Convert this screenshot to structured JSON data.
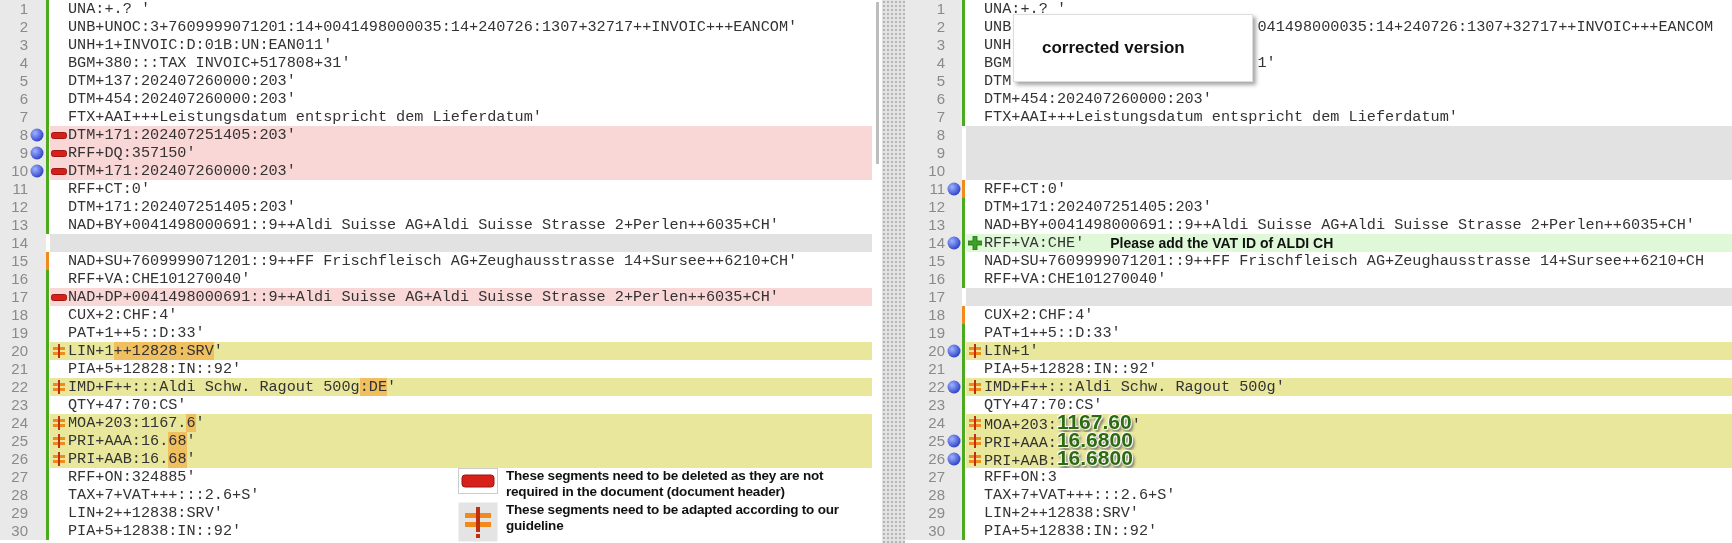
{
  "left": {
    "rows": [
      {
        "number": "1",
        "kind": "normal",
        "color": "#4caa1e",
        "dot": false,
        "text": "UNA:+.? '"
      },
      {
        "number": "2",
        "kind": "normal",
        "color": "#4caa1e",
        "dot": false,
        "text": "UNB+UNOC:3+7609999071201:14+0041498000035:14+240726:1307+32717++INVOIC+++EANCOM'"
      },
      {
        "number": "3",
        "kind": "normal",
        "color": "#4caa1e",
        "dot": false,
        "text": "UNH+1+INVOIC:D:01B:UN:EAN011'"
      },
      {
        "number": "4",
        "kind": "normal",
        "color": "#4caa1e",
        "dot": false,
        "text": "BGM+380:::TAX INVOIC+517808+31'"
      },
      {
        "number": "5",
        "kind": "normal",
        "color": "#4caa1e",
        "dot": false,
        "text": "DTM+137:202407260000:203'"
      },
      {
        "number": "6",
        "kind": "normal",
        "color": "#4caa1e",
        "dot": false,
        "text": "DTM+454:202407260000:203'"
      },
      {
        "number": "7",
        "kind": "normal",
        "color": "#4caa1e",
        "dot": false,
        "text": "FTX+AAI+++Leistungsdatum entspricht dem Lieferdatum'"
      },
      {
        "number": "8",
        "kind": "deleted",
        "color": "#4caa1e",
        "dot": true,
        "text": "DTM+171:202407251405:203'"
      },
      {
        "number": "9",
        "kind": "deleted",
        "color": "#4caa1e",
        "dot": true,
        "text": "RFF+DQ:357150'"
      },
      {
        "number": "10",
        "kind": "deleted",
        "color": "#4caa1e",
        "dot": true,
        "text": "DTM+171:202407260000:203'"
      },
      {
        "number": "11",
        "kind": "normal",
        "color": "#4caa1e",
        "dot": false,
        "text": "RFF+CT:0'"
      },
      {
        "number": "12",
        "kind": "normal",
        "color": "#4caa1e",
        "dot": false,
        "text": "DTM+171:202407251405:203'"
      },
      {
        "number": "13",
        "kind": "normal",
        "color": "#4caa1e",
        "dot": false,
        "text": "NAD+BY+0041498000691::9++Aldi Suisse AG+Aldi Suisse Strasse 2+Perlen++6035+CH'"
      },
      {
        "number": "14",
        "kind": "blank",
        "dot": false
      },
      {
        "number": "15",
        "kind": "normal",
        "color": "#f08a1c",
        "dot": false,
        "text": "NAD+SU+7609999071201::9++FF Frischfleisch AG+Zeughausstrasse 14+Sursee++6210+CH'"
      },
      {
        "number": "16",
        "kind": "normal",
        "color": "#4caa1e",
        "dot": false,
        "text": "RFF+VA:CHE101270040'"
      },
      {
        "number": "17",
        "kind": "deleted",
        "color": "#4caa1e",
        "dot": false,
        "text": "NAD+DP+0041498000691::9++Aldi Suisse AG+Aldi Suisse Strasse 2+Perlen++6035+CH'"
      },
      {
        "number": "18",
        "kind": "normal",
        "color": "#4caa1e",
        "dot": false,
        "text": "CUX+2:CHF:4'"
      },
      {
        "number": "19",
        "kind": "normal",
        "color": "#4caa1e",
        "dot": false,
        "text": "PAT+1++5::D:33'"
      },
      {
        "number": "20",
        "kind": "changed",
        "color": "#4caa1e",
        "dot": false,
        "segments": [
          {
            "kind": "plain",
            "text": "LIN+1"
          },
          {
            "kind": "highlight",
            "text": "++12828:SRV"
          },
          {
            "kind": "plain",
            "text": "'"
          }
        ]
      },
      {
        "number": "21",
        "kind": "normal",
        "color": "#4caa1e",
        "dot": false,
        "text": "PIA+5+12828:IN::92'"
      },
      {
        "number": "22",
        "kind": "changed",
        "color": "#4caa1e",
        "dot": false,
        "segments": [
          {
            "kind": "plain",
            "text": "IMD+F++:::Aldi Schw. Ragout 500g"
          },
          {
            "kind": "highlight",
            "text": ":DE"
          },
          {
            "kind": "plain",
            "text": "'"
          }
        ]
      },
      {
        "number": "23",
        "kind": "normal",
        "color": "#4caa1e",
        "dot": false,
        "text": "QTY+47:70:CS'"
      },
      {
        "number": "24",
        "kind": "changed",
        "color": "#4caa1e",
        "dot": false,
        "segments": [
          {
            "kind": "plain",
            "text": "MOA+203:1167."
          },
          {
            "kind": "highlight",
            "text": "6"
          },
          {
            "kind": "plain",
            "text": "'"
          }
        ]
      },
      {
        "number": "25",
        "kind": "changed",
        "color": "#4caa1e",
        "dot": false,
        "segments": [
          {
            "kind": "plain",
            "text": "PRI+AAA:16."
          },
          {
            "kind": "highlight",
            "text": "68"
          },
          {
            "kind": "plain",
            "text": "'"
          }
        ]
      },
      {
        "number": "26",
        "kind": "changed",
        "color": "#4caa1e",
        "dot": false,
        "segments": [
          {
            "kind": "plain",
            "text": "PRI+AAB:16."
          },
          {
            "kind": "highlight",
            "text": "68"
          },
          {
            "kind": "plain",
            "text": "'"
          }
        ]
      },
      {
        "number": "27",
        "kind": "normal",
        "color": "#4caa1e",
        "dot": false,
        "text": "RFF+ON:324885'"
      },
      {
        "number": "28",
        "kind": "normal",
        "color": "#4caa1e",
        "dot": false,
        "text": "TAX+7+VAT+++:::2.6+S'"
      },
      {
        "number": "29",
        "kind": "normal",
        "color": "#4caa1e",
        "dot": false,
        "text": "LIN+2++12838:SRV'"
      },
      {
        "number": "30",
        "kind": "normal",
        "color": "#4caa1e",
        "dot": false,
        "text": "PIA+5+12838:IN::92'"
      }
    ],
    "legend": [
      {
        "kind": "delete",
        "text": "These segments need to be deleted as they are not required in the document (document header)"
      },
      {
        "kind": "adapt",
        "text": "These segments need to be adapted according to our guideline"
      }
    ]
  },
  "right": {
    "popup": "corrected version",
    "rows": [
      {
        "number": "1",
        "kind": "normal",
        "color": "#4caa1e",
        "dot": false,
        "text": "UNA:+.? '"
      },
      {
        "number": "2",
        "kind": "normal",
        "color": "#4caa1e",
        "dot": false,
        "segments": [
          {
            "kind": "plain",
            "text": "UNB"
          },
          {
            "kind": "resume",
            "text": "041498000035:14+240726:1307+32717++INVOIC+++EANCOM"
          }
        ]
      },
      {
        "number": "3",
        "kind": "normal",
        "color": "#4caa1e",
        "dot": false,
        "text": "UNH"
      },
      {
        "number": "4",
        "kind": "normal",
        "color": "#4caa1e",
        "dot": false,
        "segments": [
          {
            "kind": "plain",
            "text": "BGM"
          },
          {
            "kind": "resume",
            "text": "1'"
          }
        ]
      },
      {
        "number": "5",
        "kind": "normal",
        "color": "#4caa1e",
        "dot": false,
        "text": "DTM"
      },
      {
        "number": "6",
        "kind": "normal",
        "color": "#4caa1e",
        "dot": false,
        "text": "DTM+454:202407260000:203'"
      },
      {
        "number": "7",
        "kind": "normal",
        "color": "#4caa1e",
        "dot": false,
        "text": "FTX+AAI+++Leistungsdatum entspricht dem Lieferdatum'"
      },
      {
        "number": "8",
        "kind": "blank",
        "dot": false
      },
      {
        "number": "9",
        "kind": "blank",
        "dot": false
      },
      {
        "number": "10",
        "kind": "blank",
        "dot": false
      },
      {
        "number": "11",
        "kind": "normal",
        "color": "#f08a1c",
        "dot": true,
        "text": "RFF+CT:0'"
      },
      {
        "number": "12",
        "kind": "normal",
        "color": "#4caa1e",
        "dot": false,
        "text": "DTM+171:202407251405:203'"
      },
      {
        "number": "13",
        "kind": "normal",
        "color": "#4caa1e",
        "dot": false,
        "text": "NAD+BY+0041498000691::9++Aldi Suisse AG+Aldi Suisse Strasse 2+Perlen++6035+CH'"
      },
      {
        "number": "14",
        "kind": "added",
        "color": "#4caa1e",
        "dot": true,
        "text": "RFF+VA:CHE'",
        "note": "Please add the VAT ID of ALDI CH"
      },
      {
        "number": "15",
        "kind": "normal",
        "color": "#4caa1e",
        "dot": false,
        "text": "NAD+SU+7609999071201::9++FF Frischfleisch AG+Zeughausstrasse 14+Sursee++6210+CH"
      },
      {
        "number": "16",
        "kind": "normal",
        "color": "#4caa1e",
        "dot": false,
        "text": "RFF+VA:CHE101270040'"
      },
      {
        "number": "17",
        "kind": "blank",
        "dot": false
      },
      {
        "number": "18",
        "kind": "normal",
        "color": "#f08a1c",
        "dot": false,
        "text": "CUX+2:CHF:4'"
      },
      {
        "number": "19",
        "kind": "normal",
        "color": "#4caa1e",
        "dot": false,
        "text": "PAT+1++5::D:33'"
      },
      {
        "number": "20",
        "kind": "changed",
        "color": "#4caa1e",
        "dot": true,
        "text": "LIN+1'"
      },
      {
        "number": "21",
        "kind": "normal",
        "color": "#4caa1e",
        "dot": false,
        "text": "PIA+5+12828:IN::92'"
      },
      {
        "number": "22",
        "kind": "changed",
        "color": "#4caa1e",
        "dot": true,
        "text": "IMD+F++:::Aldi Schw. Ragout 500g'"
      },
      {
        "number": "23",
        "kind": "normal",
        "color": "#4caa1e",
        "dot": false,
        "text": "QTY+47:70:CS'"
      },
      {
        "number": "24",
        "kind": "changed",
        "color": "#4caa1e",
        "dot": false,
        "segments": [
          {
            "kind": "plain",
            "text": "MOA+203:"
          },
          {
            "kind": "callout",
            "text": "1167.60"
          },
          {
            "kind": "plain",
            "text": "'"
          }
        ]
      },
      {
        "number": "25",
        "kind": "changed",
        "color": "#4caa1e",
        "dot": true,
        "segments": [
          {
            "kind": "plain",
            "text": "PRI+AAA:"
          },
          {
            "kind": "callout",
            "text": "16.6800"
          }
        ]
      },
      {
        "number": "26",
        "kind": "changed",
        "color": "#4caa1e",
        "dot": true,
        "segments": [
          {
            "kind": "plain",
            "text": "PRI+AAB:"
          },
          {
            "kind": "callout",
            "text": "16.6800"
          }
        ]
      },
      {
        "number": "27",
        "kind": "normal",
        "color": "#4caa1e",
        "dot": false,
        "text": "RFF+ON:3"
      },
      {
        "number": "28",
        "kind": "normal",
        "color": "#4caa1e",
        "dot": false,
        "text": "TAX+7+VAT+++:::2.6+S'"
      },
      {
        "number": "29",
        "kind": "normal",
        "color": "#4caa1e",
        "dot": false,
        "text": "LIN+2++12838:SRV'"
      },
      {
        "number": "30",
        "kind": "normal",
        "color": "#4caa1e",
        "dot": false,
        "text": "PIA+5+12838:IN::92'"
      }
    ]
  }
}
